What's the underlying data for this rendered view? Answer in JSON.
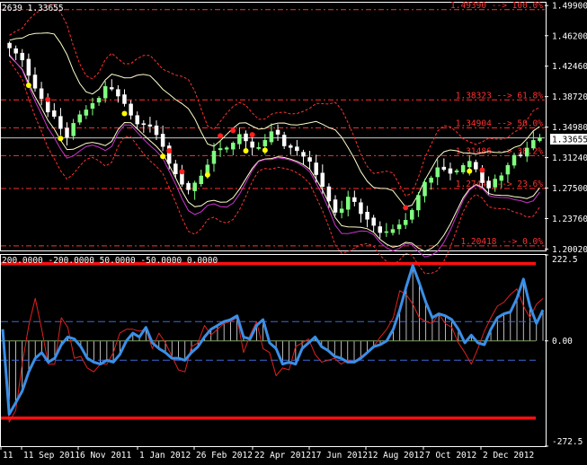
{
  "chart_data": [
    {
      "type": "candlestick",
      "header": "2639 1.33655",
      "current_price_label": "1.33655",
      "ylim": [
        1.1985,
        1.5025
      ],
      "y_ticks": [
        "1.49900",
        "1.46200",
        "1.42460",
        "1.38720",
        "1.34980",
        "1.31240",
        "1.27500",
        "1.23760",
        "1.20020"
      ],
      "fib_levels": [
        {
          "label": "1.49390 --> 100.0%",
          "price": 1.4939
        },
        {
          "label": "1.38323 --> 61.8%",
          "price": 1.38323
        },
        {
          "label": "1.34904 --> 50.0%",
          "price": 1.34904
        },
        {
          "label": "1.31486 --> 38.2%",
          "price": 1.31486
        },
        {
          "label": "1.27445 --> 23.6%",
          "price": 1.27445
        },
        {
          "label": "1.20418 --> 0.0%",
          "price": 1.20418
        }
      ],
      "fib_color": "#ff3030",
      "current_price": 1.33655,
      "candles_close": [
        1.4469,
        1.4405,
        1.4322,
        1.4133,
        1.3975,
        1.3849,
        1.3683,
        1.363,
        1.348,
        1.3375,
        1.3545,
        1.3651,
        1.371,
        1.3789,
        1.3853,
        1.3997,
        1.3966,
        1.3879,
        1.3786,
        1.3644,
        1.3537,
        1.3529,
        1.3509,
        1.3405,
        1.326,
        1.3053,
        1.2924,
        1.2797,
        1.273,
        1.2814,
        1.2899,
        1.3034,
        1.3204,
        1.3236,
        1.3245,
        1.3303,
        1.3409,
        1.3329,
        1.325,
        1.3249,
        1.3336,
        1.3443,
        1.341,
        1.3268,
        1.3248,
        1.3209,
        1.314,
        1.3078,
        1.2915,
        1.277,
        1.2592,
        1.2453,
        1.2495,
        1.2641,
        1.2584,
        1.2436,
        1.2367,
        1.2292,
        1.2204,
        1.2216,
        1.2243,
        1.23,
        1.2356,
        1.2479,
        1.2662,
        1.2822,
        1.2875,
        1.3001,
        1.2978,
        1.2931,
        1.2964,
        1.3029,
        1.308,
        1.2983,
        1.2816,
        1.2751,
        1.2861,
        1.2902,
        1.303,
        1.3153,
        1.315,
        1.3242,
        1.3336,
        1.3366
      ],
      "bollinger_color": "#ffffcc",
      "envelope_color": "#ff3030",
      "ma_color": "#cc33cc",
      "bull_color": "#80ff80",
      "bear_color": "#ffffff",
      "dot_colors": [
        "#ffff00",
        "#ff2020"
      ],
      "up_dots": [
        3,
        8,
        18,
        24,
        31,
        37,
        40,
        72
      ],
      "down_dots": [
        6,
        25,
        27,
        33,
        35,
        38,
        62,
        74
      ]
    },
    {
      "type": "oscillator",
      "header": "200.0000 -200.0000 50.0000 -50.0000 0.0000",
      "ylim": [
        -272.5,
        222.5
      ],
      "y_ticks": [
        "222.5",
        "0.00",
        "-272.5"
      ],
      "levels": [
        200,
        -200,
        50,
        -50,
        0
      ],
      "level_color": "#ff1010",
      "dash_color": "#3a6ad8",
      "main_color": "#3a8fe8",
      "signal_color": "#e02020",
      "hist_color": "#ffffff",
      "main": [
        30,
        -190,
        -160,
        -130,
        -80,
        -45,
        -30,
        -55,
        -45,
        -10,
        10,
        5,
        -15,
        -45,
        -55,
        -60,
        -50,
        -55,
        -35,
        0,
        20,
        10,
        35,
        -5,
        -20,
        -30,
        -45,
        -45,
        -50,
        -30,
        -15,
        10,
        30,
        40,
        50,
        55,
        65,
        10,
        5,
        40,
        55,
        -5,
        -20,
        -60,
        -55,
        -60,
        -20,
        -5,
        10,
        -15,
        -25,
        -40,
        -45,
        -55,
        -55,
        -45,
        -30,
        -15,
        -10,
        0,
        30,
        80,
        140,
        195,
        150,
        100,
        60,
        70,
        65,
        55,
        30,
        -5,
        15,
        -5,
        -10,
        30,
        60,
        70,
        75,
        110,
        160,
        90,
        45,
        80
      ],
      "signal": [
        15,
        -210,
        -180,
        -60,
        40,
        110,
        30,
        -60,
        -60,
        60,
        35,
        -45,
        -40,
        -70,
        -80,
        -60,
        -60,
        -30,
        20,
        30,
        30,
        25,
        30,
        -20,
        20,
        -5,
        -40,
        -75,
        -80,
        -15,
        -5,
        40,
        15,
        30,
        45,
        50,
        60,
        -30,
        15,
        50,
        -20,
        -30,
        -90,
        -70,
        -75,
        -15,
        -5,
        5,
        -35,
        -55,
        -50,
        -45,
        -60,
        -50,
        -55,
        -40,
        -30,
        -15,
        10,
        30,
        60,
        130,
        120,
        95,
        60,
        50,
        45,
        70,
        45,
        35,
        -5,
        -30,
        -60,
        -20,
        25,
        60,
        90,
        100,
        120,
        135,
        90,
        60,
        95,
        110
      ],
      "x_labels": [
        "11",
        "11 Sep 2011",
        "6 Nov 2011",
        "1 Jan 2012",
        "26 Feb 2012",
        "22 Apr 2012",
        "17 Jun 2012",
        "12 Aug 2012",
        "7 Oct 2012",
        "2 Dec 2012"
      ]
    }
  ]
}
